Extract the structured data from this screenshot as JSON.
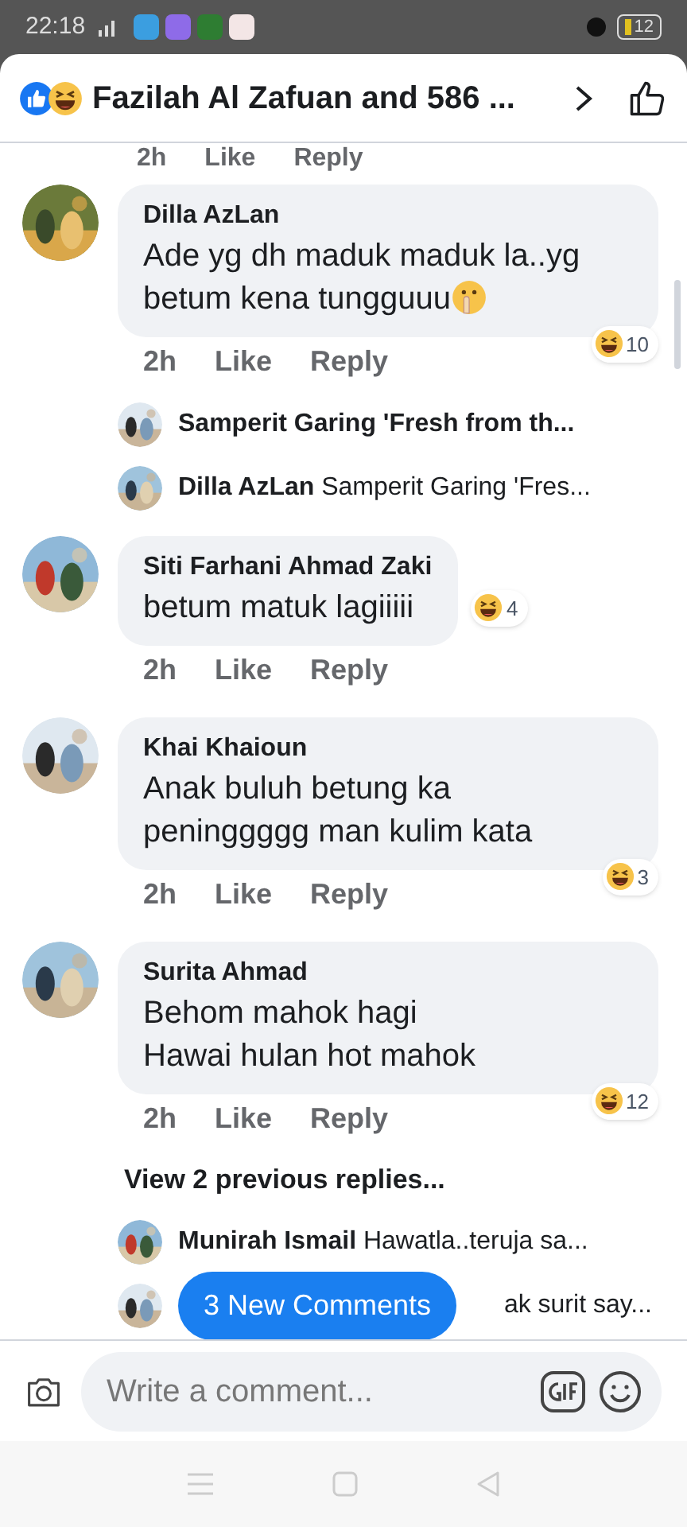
{
  "status_bar": {
    "time": "22:18",
    "battery": "12"
  },
  "header": {
    "title": "Fazilah Al Zafuan and 586 ..."
  },
  "top_actions": {
    "time": "2h",
    "like": "Like",
    "reply": "Reply"
  },
  "comments": [
    {
      "name": "Dilla AzLan",
      "text": "Ade yg dh maduk maduk la..yg betum kena tungguuu",
      "has_emoji": true,
      "reactions": "10",
      "time": "2h",
      "like": "Like",
      "reply": "Reply",
      "replies": [
        {
          "kind": "reply",
          "name": "Samperit Garing 'Fresh from th..."
        },
        {
          "kind": "reply",
          "name": "Dilla AzLan",
          "text": "Samperit Garing 'Fres..."
        }
      ]
    },
    {
      "name": "Siti Farhani Ahmad Zaki",
      "text": "betum matuk lagiiiii",
      "has_emoji": false,
      "reactions": "4",
      "time": "2h",
      "like": "Like",
      "reply": "Reply"
    },
    {
      "name": "Khai Khaioun",
      "text": "Anak buluh betung ka peninggggg man kulim kata",
      "has_emoji": false,
      "reactions": "3",
      "time": "2h",
      "like": "Like",
      "reply": "Reply"
    },
    {
      "name": "Surita Ahmad",
      "text": "Behom mahok hagi\nHawai hulan hot mahok",
      "has_emoji": false,
      "reactions": "12",
      "time": "2h",
      "like": "Like",
      "reply": "Reply",
      "replies": [
        {
          "kind": "view_more",
          "text": "View 2 previous replies..."
        },
        {
          "kind": "reply",
          "name": "Munirah Ismail",
          "text": "Hawatla..teruja sa..."
        },
        {
          "kind": "covered_reply",
          "text": "ak surit say..."
        }
      ]
    }
  ],
  "new_comments_button": "3 New Comments",
  "composer": {
    "placeholder": "Write a comment..."
  }
}
